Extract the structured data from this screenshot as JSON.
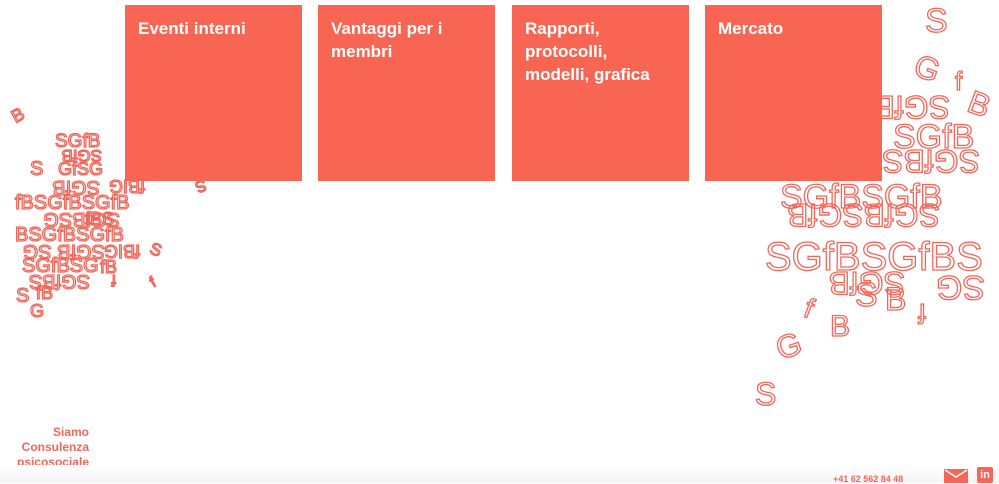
{
  "tiles": [
    {
      "label": "Eventi interni"
    },
    {
      "label": "Vantaggi per i membri"
    },
    {
      "label": "Rapporti, protocolli, modelli, grafica"
    },
    {
      "label": "Mercato"
    }
  ],
  "tagline": {
    "lines": [
      "Siamo",
      "Consulenza",
      "psicosociale"
    ]
  },
  "footer": {
    "phone": "+41 62 562 84 48",
    "mail_icon": "mail-icon",
    "linkedin_icon": "linkedin-icon",
    "linkedin_glyph": "in"
  },
  "decoration": {
    "letters": "SGfB",
    "color": "#f2665a"
  },
  "colors": {
    "tile": "#f86553",
    "accent": "#f2665a",
    "background": "#ffffff"
  }
}
